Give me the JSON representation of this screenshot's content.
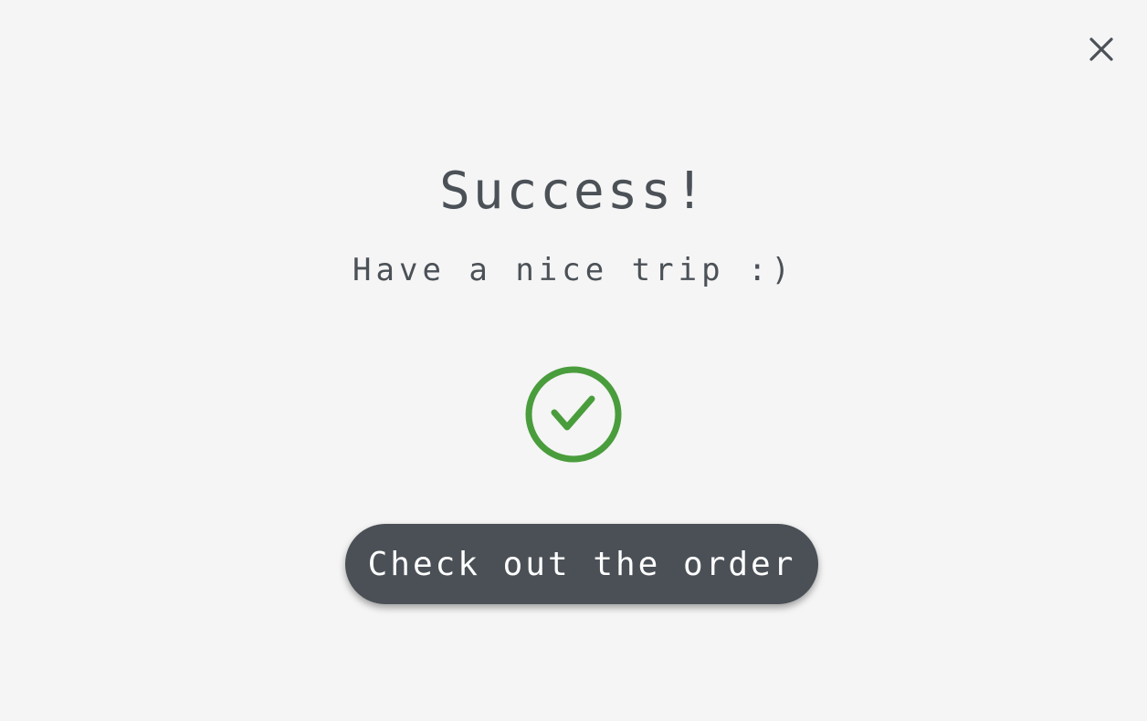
{
  "dialog": {
    "title": "Success!",
    "subtitle": "Have a nice trip :)",
    "cta_label": "Check out the order",
    "close_icon": "close-icon",
    "status_icon": "check-circle-icon"
  },
  "colors": {
    "background": "#f5f5f5",
    "text": "#4b5157",
    "success": "#4a9d3c",
    "button_bg": "#4a5056",
    "button_text": "#ffffff"
  }
}
